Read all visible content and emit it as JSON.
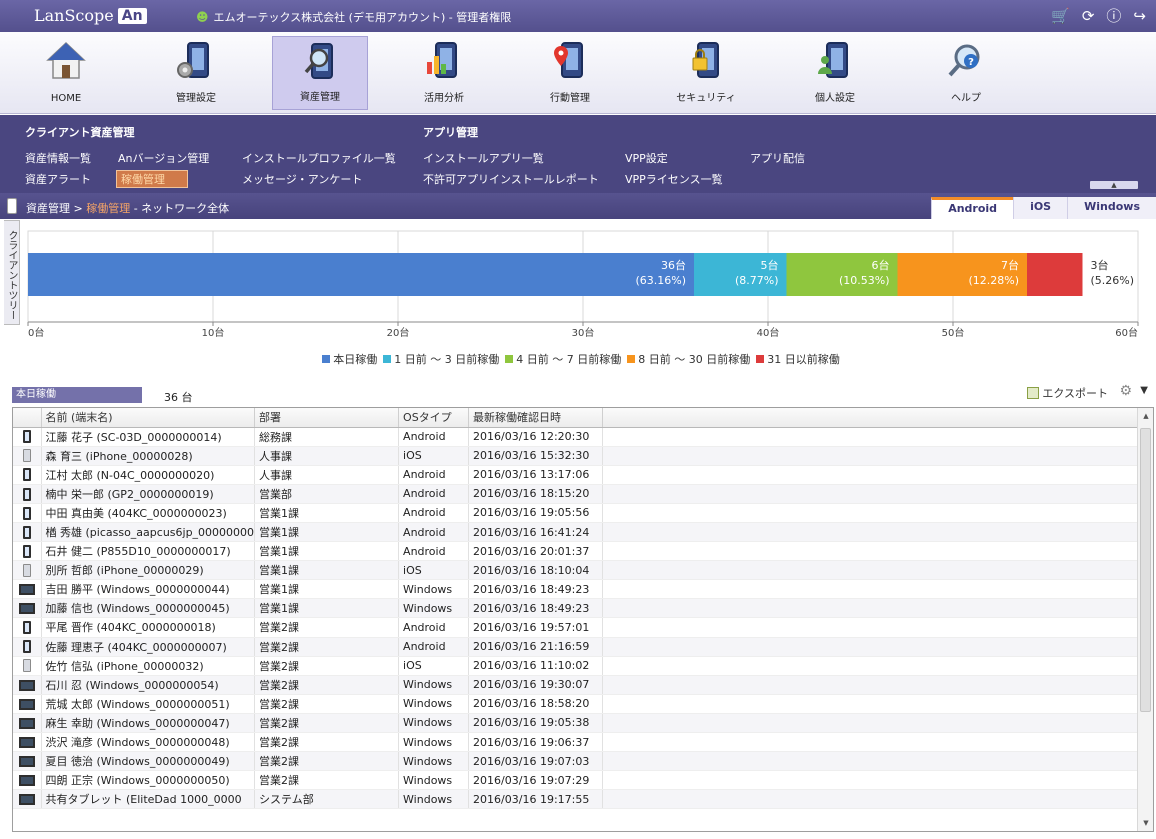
{
  "header": {
    "logo_text": "LanScope",
    "logo_badge": "An",
    "company": "エムオーテックス株式会社 (デモ用アカウント) - 管理者権限",
    "icons": [
      "cart-icon",
      "refresh-icon",
      "info-icon",
      "logout-icon"
    ]
  },
  "nav": {
    "items": [
      {
        "label": "HOME",
        "icon": "home-icon"
      },
      {
        "label": "管理設定",
        "icon": "settings-phone-icon"
      },
      {
        "label": "資産管理",
        "icon": "asset-search-icon",
        "active": true
      },
      {
        "label": "活用分析",
        "icon": "analytics-icon"
      },
      {
        "label": "行動管理",
        "icon": "location-icon"
      },
      {
        "label": "セキュリティ",
        "icon": "lock-icon"
      },
      {
        "label": "個人設定",
        "icon": "user-phone-icon"
      },
      {
        "label": "ヘルプ",
        "icon": "help-icon"
      }
    ]
  },
  "submenu": {
    "client_heading": "クライアント資産管理",
    "app_heading": "アプリ管理",
    "client_links_row1": [
      "資産情報一覧",
      "Anバージョン管理",
      "インストールプロファイル一覧"
    ],
    "client_links_row2": [
      "資産アラート",
      "稼働管理",
      "メッセージ・アンケート"
    ],
    "app_links_row1": [
      "インストールアプリ一覧",
      "VPP設定",
      "アプリ配信"
    ],
    "app_links_row2": [
      "不許可アプリインストールレポート",
      "VPPライセンス一覧"
    ]
  },
  "breadcrumb": {
    "root": "資産管理",
    "sep": " > ",
    "current": "稼働管理",
    "suffix": " - ネットワーク全体"
  },
  "os_tabs": [
    "Android",
    "iOS",
    "Windows"
  ],
  "side_tab": "クライアントツリー",
  "chart_data": {
    "type": "bar",
    "orientation": "horizontal-stacked",
    "xlim": [
      0,
      60
    ],
    "x_ticks": [
      "0台",
      "10台",
      "20台",
      "30台",
      "40台",
      "50台",
      "60台"
    ],
    "series": [
      {
        "name": "本日稼働",
        "value": 36,
        "label": "36台",
        "pct": "(63.16%)",
        "color": "#4a7fcf"
      },
      {
        "name": "1 日前 ～ 3 日前稼働",
        "value": 5,
        "label": "5台",
        "pct": "(8.77%)",
        "color": "#3cb6d6"
      },
      {
        "name": "4 日前 ～ 7 日前稼働",
        "value": 6,
        "label": "6台",
        "pct": "(10.53%)",
        "color": "#8fc63e"
      },
      {
        "name": "8 日前 ～ 30 日前稼働",
        "value": 7,
        "label": "7台",
        "pct": "(12.28%)",
        "color": "#f7941d"
      },
      {
        "name": "31 日以前稼働",
        "value": 3,
        "label": "3台",
        "pct": "(5.26%)",
        "color": "#dd3b3b"
      }
    ]
  },
  "summary": {
    "label": "本日稼働",
    "count": "36 台"
  },
  "toolbar": {
    "export_label": "エクスポート"
  },
  "table": {
    "columns": [
      "名前 (端末名)",
      "部署",
      "OSタイプ",
      "最新稼働確認日時"
    ],
    "rows": [
      {
        "os": "android",
        "name": "江藤 花子 (SC-03D_0000000014)",
        "dept": "総務課",
        "type": "Android",
        "time": "2016/03/16 12:20:30"
      },
      {
        "os": "ios",
        "name": "森 育三 (iPhone_00000028)",
        "dept": "人事課",
        "type": "iOS",
        "time": "2016/03/16 15:32:30"
      },
      {
        "os": "android",
        "name": "江村 太郎 (N-04C_0000000020)",
        "dept": "人事課",
        "type": "Android",
        "time": "2016/03/16 13:17:06"
      },
      {
        "os": "android",
        "name": "楠中 栄一郎 (GP2_0000000019)",
        "dept": "営業部",
        "type": "Android",
        "time": "2016/03/16 18:15:20"
      },
      {
        "os": "android",
        "name": "中田 真由美 (404KC_0000000023)",
        "dept": "営業1課",
        "type": "Android",
        "time": "2016/03/16 19:05:56"
      },
      {
        "os": "android",
        "name": "楢 秀雄 (picasso_aapcus6jp_00000000",
        "dept": "営業1課",
        "type": "Android",
        "time": "2016/03/16 16:41:24"
      },
      {
        "os": "android",
        "name": "石井 健二 (P855D10_0000000017)",
        "dept": "営業1課",
        "type": "Android",
        "time": "2016/03/16 20:01:37"
      },
      {
        "os": "ios",
        "name": "別所 哲郎 (iPhone_00000029)",
        "dept": "営業1課",
        "type": "iOS",
        "time": "2016/03/16 18:10:04"
      },
      {
        "os": "windows",
        "name": "吉田 勝平 (Windows_0000000044)",
        "dept": "営業1課",
        "type": "Windows",
        "time": "2016/03/16 18:49:23"
      },
      {
        "os": "windows",
        "name": "加藤 信也 (Windows_0000000045)",
        "dept": "営業1課",
        "type": "Windows",
        "time": "2016/03/16 18:49:23"
      },
      {
        "os": "android",
        "name": "平尾 晋作 (404KC_0000000018)",
        "dept": "営業2課",
        "type": "Android",
        "time": "2016/03/16 19:57:01"
      },
      {
        "os": "android",
        "name": "佐藤 理恵子 (404KC_0000000007)",
        "dept": "営業2課",
        "type": "Android",
        "time": "2016/03/16 21:16:59"
      },
      {
        "os": "ios",
        "name": "佐竹 信弘 (iPhone_00000032)",
        "dept": "営業2課",
        "type": "iOS",
        "time": "2016/03/16 11:10:02"
      },
      {
        "os": "windows",
        "name": "石川 忍 (Windows_0000000054)",
        "dept": "営業2課",
        "type": "Windows",
        "time": "2016/03/16 19:30:07"
      },
      {
        "os": "windows",
        "name": "荒城 太郎 (Windows_0000000051)",
        "dept": "営業2課",
        "type": "Windows",
        "time": "2016/03/16 18:58:20"
      },
      {
        "os": "windows",
        "name": "麻生 幸助 (Windows_0000000047)",
        "dept": "営業2課",
        "type": "Windows",
        "time": "2016/03/16 19:05:38"
      },
      {
        "os": "windows",
        "name": "渋沢 滝彦 (Windows_0000000048)",
        "dept": "営業2課",
        "type": "Windows",
        "time": "2016/03/16 19:06:37"
      },
      {
        "os": "windows",
        "name": "夏目 徳治 (Windows_0000000049)",
        "dept": "営業2課",
        "type": "Windows",
        "time": "2016/03/16 19:07:03"
      },
      {
        "os": "windows",
        "name": "四朗 正宗 (Windows_0000000050)",
        "dept": "営業2課",
        "type": "Windows",
        "time": "2016/03/16 19:07:29"
      },
      {
        "os": "windows",
        "name": "共有タブレット (EliteDad 1000_0000",
        "dept": "システム部",
        "type": "Windows",
        "time": "2016/03/16 19:17:55"
      }
    ]
  }
}
